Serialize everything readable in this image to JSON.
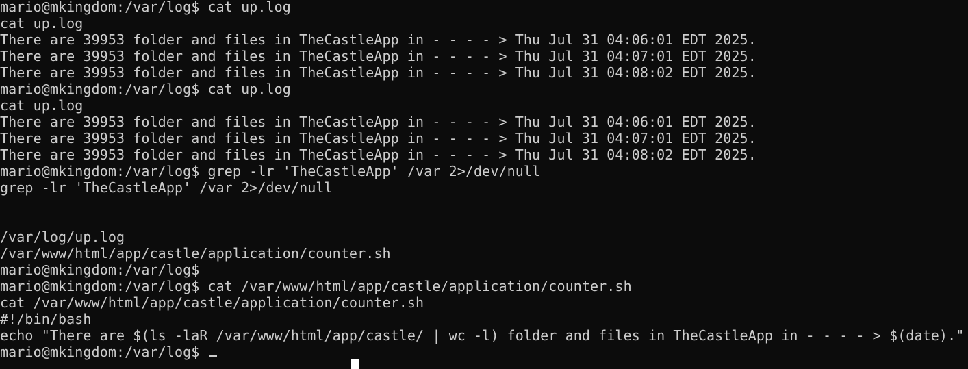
{
  "terminal": {
    "lines": [
      "mario@mkingdom:/var/log$ cat up.log",
      "cat up.log",
      "There are 39953 folder and files in TheCastleApp in - - - - > Thu Jul 31 04:06:01 EDT 2025.",
      "There are 39953 folder and files in TheCastleApp in - - - - > Thu Jul 31 04:07:01 EDT 2025.",
      "There are 39953 folder and files in TheCastleApp in - - - - > Thu Jul 31 04:08:02 EDT 2025.",
      "mario@mkingdom:/var/log$ cat up.log",
      "cat up.log",
      "There are 39953 folder and files in TheCastleApp in - - - - > Thu Jul 31 04:06:01 EDT 2025.",
      "There are 39953 folder and files in TheCastleApp in - - - - > Thu Jul 31 04:07:01 EDT 2025.",
      "There are 39953 folder and files in TheCastleApp in - - - - > Thu Jul 31 04:08:02 EDT 2025.",
      "mario@mkingdom:/var/log$ grep -lr 'TheCastleApp' /var 2>/dev/null",
      "grep -lr 'TheCastleApp' /var 2>/dev/null",
      "",
      "",
      "/var/log/up.log",
      "/var/www/html/app/castle/application/counter.sh",
      "mario@mkingdom:/var/log$",
      "mario@mkingdom:/var/log$ cat /var/www/html/app/castle/application/counter.sh",
      "cat /var/www/html/app/castle/application/counter.sh",
      "#!/bin/bash",
      "echo \"There are $(ls -laR /var/www/html/app/castle/ | wc -l) folder and files in TheCastleApp in - - - - > $(date).\"",
      "mario@mkingdom:/var/log$ "
    ]
  }
}
